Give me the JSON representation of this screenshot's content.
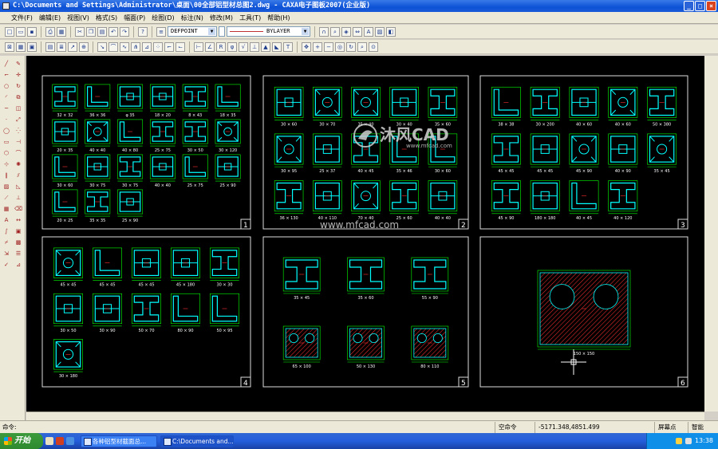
{
  "window": {
    "title": "C:\\Documents and Settings\\Administrator\\桌面\\00全部铝型材总图2.dwg - CAXA电子图板2007(企业版)"
  },
  "menu": [
    "文件(F)",
    "编辑(E)",
    "视图(V)",
    "格式(S)",
    "幅面(P)",
    "绘图(D)",
    "标注(N)",
    "修改(M)",
    "工具(T)",
    "帮助(H)"
  ],
  "toolbar": {
    "layer_value": "DEFPOINT",
    "linetype_value": "BYLAYER"
  },
  "canvas": {
    "watermark_brand": "沐风CAD",
    "watermark_url": "www.mfcad.com",
    "watermark_url2": "www.mfcad.com",
    "sheets": [
      {
        "number": "1",
        "labels": [
          "32 × 32",
          "36 × 36",
          "φ 35",
          "18 × 20",
          "8 × 43",
          "18 × 35",
          "20 × 35",
          "40 × 40",
          "40 × 80",
          "25 × 75",
          "30 × 50",
          "30 × 120",
          "30 × 60",
          "30 × 75",
          "30 × 75",
          "40 × 40",
          "25 × 75",
          "25 × 90",
          "20 × 25",
          "35 × 35",
          "25 × 90"
        ]
      },
      {
        "number": "2",
        "labels": [
          "30 × 60",
          "30 × 70",
          "35 × 40",
          "30 × 40",
          "35 × 60",
          "30 × 95",
          "25 × 37",
          "40 × 45",
          "35 × 46",
          "30 × 60",
          "36 × 130",
          "40 × 110",
          "70 × 40",
          "25 × 60",
          "40 × 40"
        ]
      },
      {
        "number": "3",
        "labels": [
          "38 × 38",
          "30 × 200",
          "40 × 60",
          "40 × 60",
          "50 × 380",
          "45 × 45",
          "45 × 45",
          "45 × 90",
          "40 × 90",
          "35 × 45",
          "45 × 90",
          "180 × 180",
          "40 × 45",
          "40 × 120"
        ]
      },
      {
        "number": "4",
        "labels": [
          "45 × 45",
          "45 × 45",
          "45 × 45",
          "45 × 180",
          "30 × 30",
          "30 × 50",
          "30 × 90",
          "50 × 70",
          "80 × 90",
          "50 × 95",
          "30 × 180"
        ]
      },
      {
        "number": "5",
        "labels": [
          "35 × 45",
          "35 × 60",
          "55 × 90",
          "65 × 100",
          "50 × 130",
          "80 × 110"
        ]
      },
      {
        "number": "6",
        "labels": [
          "150 × 150"
        ]
      }
    ]
  },
  "command": {
    "prompt": "命令:",
    "status": "空命令",
    "coords": "-5171.348,4851.499",
    "mode1": "屏幕点",
    "mode2": "智能"
  },
  "taskbar": {
    "start": "开始",
    "tasks": [
      "各种铝型材截面总...",
      "C:\\Documents and..."
    ],
    "clock": "13:38"
  },
  "colors": {
    "cyan": "#00ffff",
    "green": "#00ff00",
    "white": "#ffffff",
    "red": "#ff3030",
    "titlebar": "#0d52d6"
  }
}
